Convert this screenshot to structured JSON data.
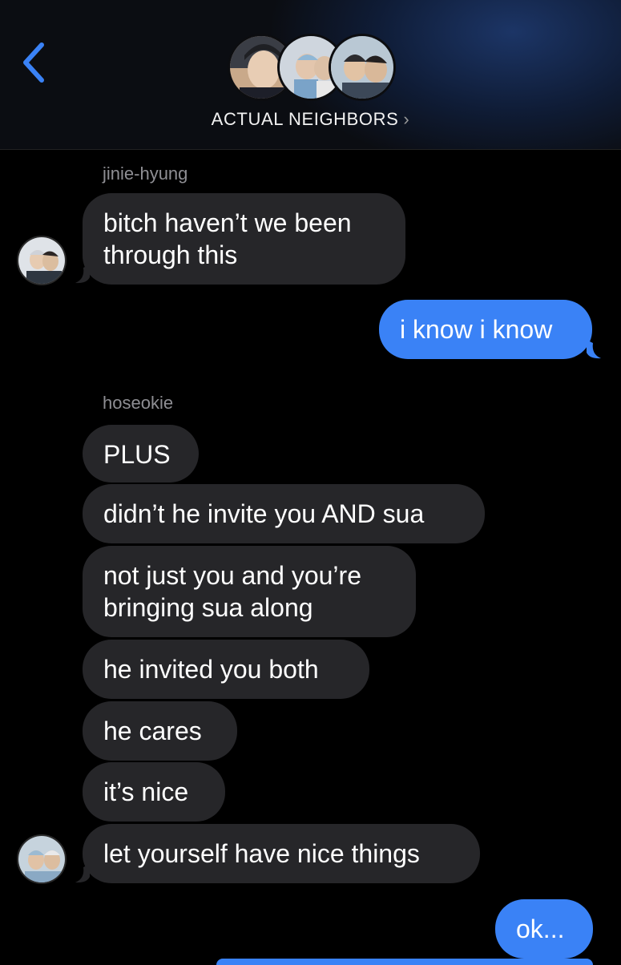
{
  "header": {
    "title": "ACTUAL NEIGHBORS",
    "colors": {
      "accent": "#3a82f6",
      "incoming_bubble": "#262629",
      "background": "#000000"
    }
  },
  "messages": [
    {
      "sender": "jinie-hyung",
      "text": "bitch haven’t we been",
      "text2": "through this"
    },
    {
      "text": "i know i know"
    },
    {
      "sender": "hoseokie",
      "lines": [
        "PLUS",
        "didn’t he invite you AND sua",
        "not just you and you’re",
        "bringing sua along",
        "he invited you both",
        "he cares",
        "it’s nice",
        "let yourself have nice things"
      ]
    },
    {
      "text": "ok..."
    }
  ]
}
